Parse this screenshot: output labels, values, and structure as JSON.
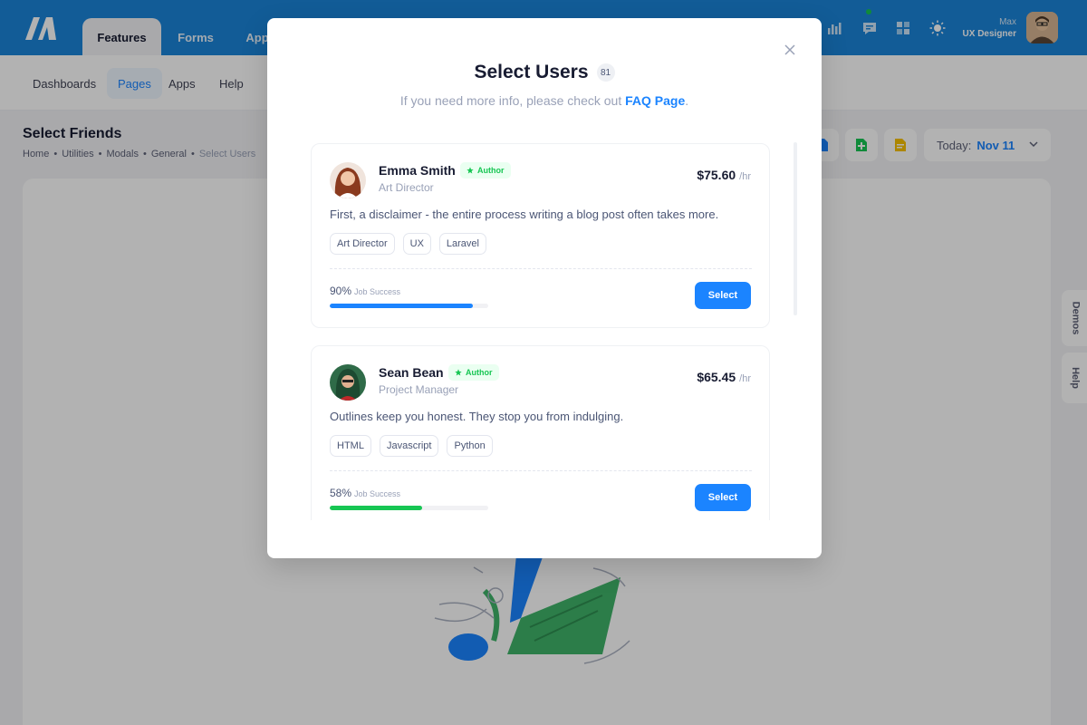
{
  "topbar": {
    "tabs": [
      "Features",
      "Forms",
      "App"
    ],
    "user": {
      "name": "Max",
      "role": "UX Designer"
    }
  },
  "subnav": {
    "items": [
      "Dashboards",
      "Pages",
      "Apps",
      "Help"
    ],
    "active": "Pages"
  },
  "toolbar": {
    "title": "Select Friends",
    "breadcrumb": [
      "Home",
      "Utilities",
      "Modals",
      "General",
      "Select Users"
    ],
    "date_label": "Today:",
    "date_value": "Nov 11"
  },
  "side_tabs": [
    "Demos",
    "Help"
  ],
  "modal": {
    "title": "Select Users",
    "count": "81",
    "subtitle_text": "If you need more info, please check out",
    "subtitle_link": "FAQ Page",
    "subtitle_end": ".",
    "users": [
      {
        "name": "Emma Smith",
        "badge": "Author",
        "role": "Art Director",
        "rate": "$75.60",
        "rate_unit": "/hr",
        "description": "First, a disclaimer - the entire process writing a blog post often takes more.",
        "tags": [
          "Art Director",
          "UX",
          "Laravel"
        ],
        "progress_label": "90%",
        "progress_caption": "Job Success",
        "progress": 0.9,
        "progress_color": "#1b84ff",
        "button": "Select"
      },
      {
        "name": "Sean Bean",
        "badge": "Author",
        "role": "Project Manager",
        "rate": "$65.45",
        "rate_unit": "/hr",
        "description": "Outlines keep you honest. They stop you from indulging.",
        "tags": [
          "HTML",
          "Javascript",
          "Python"
        ],
        "progress_label": "58%",
        "progress_caption": "Job Success",
        "progress": 0.58,
        "progress_color": "#17c653",
        "button": "Select"
      }
    ]
  },
  "colors": {
    "primary": "#1b84ff",
    "success": "#17c653",
    "topbar": "#1b84d8"
  },
  "icons": [
    "logo-icon",
    "chart-icon",
    "chat-icon",
    "grid-icon",
    "sun-icon",
    "close-icon",
    "star-icon",
    "chevron-down-icon"
  ]
}
